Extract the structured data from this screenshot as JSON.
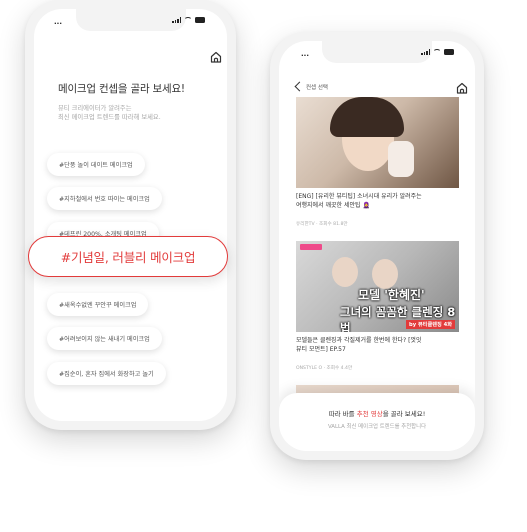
{
  "colors": {
    "accent": "#e23b3b",
    "chip_shadow": "#dddddd",
    "muted": "#a6a6a6"
  },
  "left_screen": {
    "status_time": "...",
    "title": "메이크업 컨셉을 골라 보세요!",
    "subtitle_line1": "뷰티 크리에이터가 알려주는",
    "subtitle_line2": "최신 메이크업 트렌드를 따라해 보세요.",
    "home_icon": "home-icon",
    "concepts": [
      "#단풍 놀이 데이트 메이크업",
      "#지하철에서 번호 따이는 메이크업",
      "#데프린 200%, 소개팅 메이크업",
      "#기념일, 러블리 메이크업",
      "#새옥수없엔 꾸안꾸 메이크업",
      "#어려보이지 않는 새내기 메이크업",
      "#집순이, 혼자 집에서 화장하고 놀기"
    ]
  },
  "right_screen": {
    "status_time": "...",
    "back_label": "컨셉 선택",
    "home_icon": "home-icon",
    "videos": [
      {
        "title_line1": "[ENG] [유리한 뷰티팁] 소녀시대 유리가 알려주는",
        "title_line2": "여행지에서 깨끗한 세안팁 🧕",
        "meta": "유리한TV · 조회수 81.8만"
      },
      {
        "thumb_text_top": "모델 '한혜진'",
        "thumb_text_bottom": "그녀의 꼼꼼한 클렌징 8법",
        "thumb_badge": "by 뷰티클렌징 4화",
        "title_line1": "모델들은 클렌징과 각질제거를 한번에 한다? [껏잇",
        "title_line2": "뷰티 모먼트] EP.57",
        "meta": "ONSTYLE O · 조회수 4.4만"
      }
    ],
    "sheet": {
      "line1_prefix": "따라 바를 ",
      "line1_accent": "추천 영상",
      "line1_suffix": "을 골라 보세요!",
      "line2": "VALLA 최신 메이크업 트렌드를 추천합니다"
    }
  }
}
